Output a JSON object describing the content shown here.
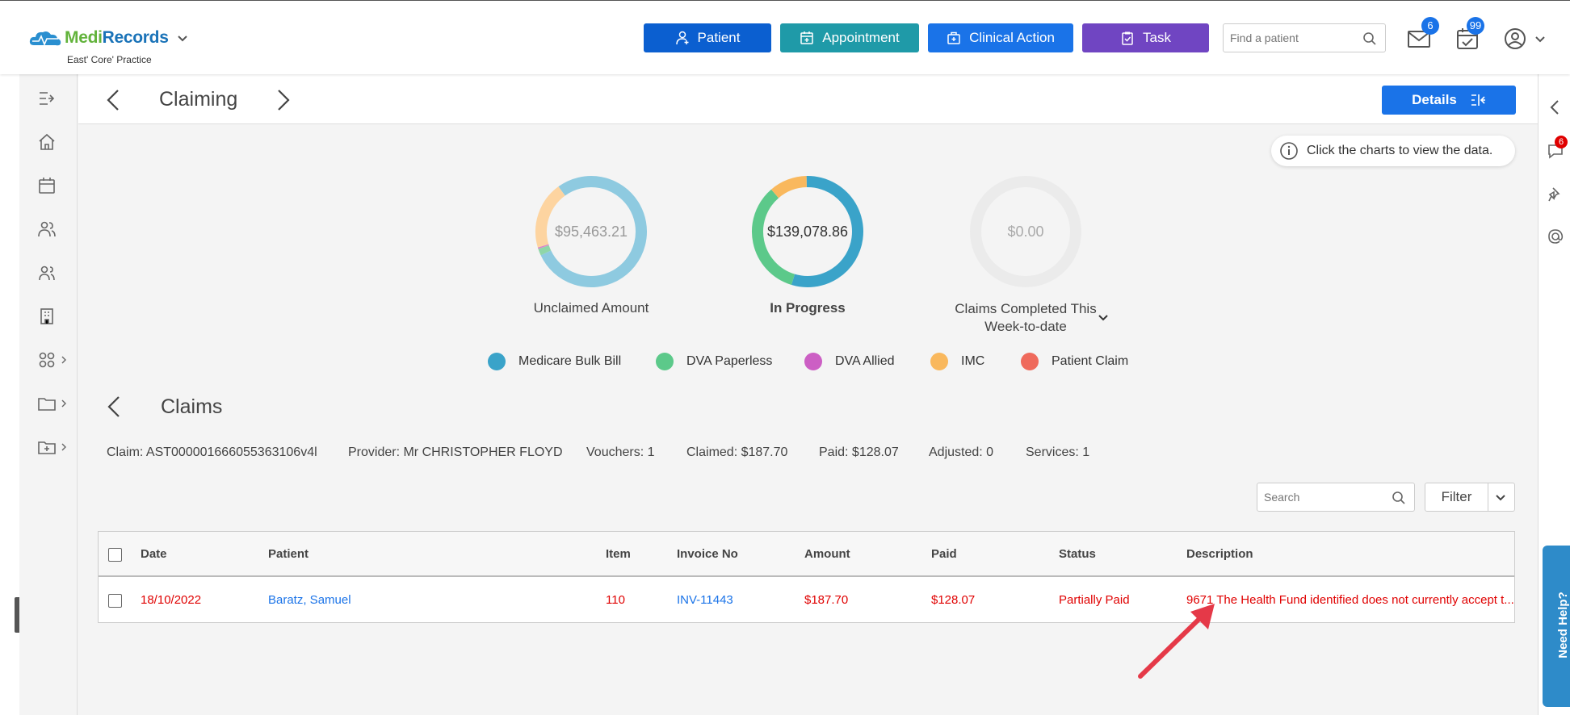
{
  "app": {
    "brand_medi": "Medi",
    "brand_records": "Records",
    "practice": "East' Core' Practice"
  },
  "toolbar": {
    "patient_label": "Patient",
    "appointment_label": "Appointment",
    "clinical_action_label": "Clinical Action",
    "task_label": "Task",
    "find_placeholder": "Find a patient",
    "mail_count": "6",
    "tasks_count": "99",
    "colors": {
      "patient": "#0b5fd0",
      "appointment": "#1f9aa8",
      "clinical_action": "#1a73e8",
      "task": "#7045c2"
    }
  },
  "header": {
    "title": "Claiming",
    "details_label": "Details"
  },
  "info": {
    "text": "Click the charts to view the data."
  },
  "chart_data": [
    {
      "type": "pie",
      "title": "Unclaimed Amount",
      "center_value": "$95,463.21",
      "categories": [
        "Medicare Bulk Bill",
        "DVA Paperless",
        "DVA Allied",
        "IMC",
        "Patient Claim"
      ],
      "values": [
        78,
        2,
        0.4,
        19.6,
        0
      ],
      "colors": [
        "#8ecae0",
        "#8fd6a8",
        "#d987c8",
        "#fdd4a0",
        "#f28b82"
      ]
    },
    {
      "type": "pie",
      "title": "In Progress",
      "center_value": "$139,078.86",
      "categories": [
        "Medicare Bulk Bill",
        "DVA Paperless",
        "DVA Allied",
        "IMC",
        "Patient Claim"
      ],
      "values": [
        55,
        34,
        0,
        11,
        0
      ],
      "colors": [
        "#3aa3c9",
        "#5cc98a",
        "#cc5fc4",
        "#f9b85d",
        "#ef6a5c"
      ]
    },
    {
      "type": "pie",
      "title": "Claims Completed This Week-to-date",
      "center_value": "$0.00",
      "categories": [
        "Medicare Bulk Bill",
        "DVA Paperless",
        "DVA Allied",
        "IMC",
        "Patient Claim"
      ],
      "values": [
        0,
        0,
        0,
        0,
        0
      ],
      "colors": [
        "#3aa3c9",
        "#5cc98a",
        "#cc5fc4",
        "#f9b85d",
        "#ef6a5c"
      ]
    }
  ],
  "legend": [
    {
      "label": "Medicare Bulk Bill",
      "color": "#3aa3c9"
    },
    {
      "label": "DVA Paperless",
      "color": "#5cc98a"
    },
    {
      "label": "DVA Allied",
      "color": "#cc5fc4"
    },
    {
      "label": "IMC",
      "color": "#f9b85d"
    },
    {
      "label": "Patient Claim",
      "color": "#ef6a5c"
    }
  ],
  "claims": {
    "title": "Claims",
    "claim": "Claim: AST000001666055363106v4l",
    "provider": "Provider: Mr CHRISTOPHER FLOYD",
    "vouchers": "Vouchers: 1",
    "claimed": "Claimed: $187.70",
    "paid": "Paid: $128.07",
    "adjusted": "Adjusted: 0",
    "services": "Services: 1",
    "search_placeholder": "Search",
    "filter_label": "Filter"
  },
  "table": {
    "headers": [
      "Date",
      "Patient",
      "Item",
      "Invoice No",
      "Amount",
      "Paid",
      "Status",
      "Description"
    ],
    "rows": [
      {
        "date": "18/10/2022",
        "patient": "Baratz, Samuel",
        "item": "110",
        "invoice": "INV-11443",
        "amount": "$187.70",
        "paid": "$128.07",
        "status": "Partially Paid",
        "description": "9671 The Health Fund identified does not currently accept t..."
      }
    ]
  },
  "side": {
    "comments_count": "6",
    "need_help": "Need Help?"
  }
}
